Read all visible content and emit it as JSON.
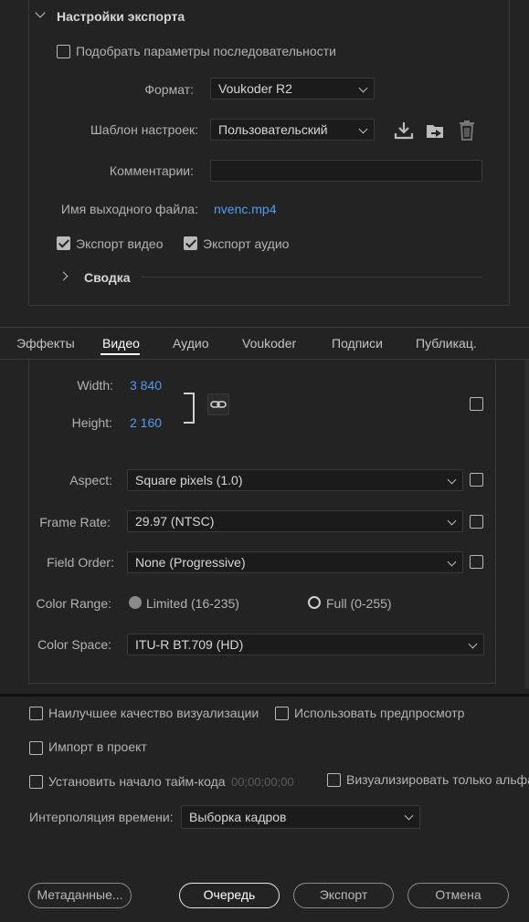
{
  "export_settings": {
    "title": "Настройки экспорта",
    "match_sequence": "Подобрать параметры последовательности",
    "format_label": "Формат:",
    "format_value": "Voukoder R2",
    "preset_label": "Шаблон настроек:",
    "preset_value": "Пользовательский",
    "comments_label": "Комментарии:",
    "comments_value": "",
    "output_name_label": "Имя выходного файла:",
    "output_name_value": "nvenc.mp4",
    "export_video": "Экспорт видео",
    "export_audio": "Экспорт аудио",
    "summary": "Сводка"
  },
  "tabs": [
    "Эффекты",
    "Видео",
    "Аудио",
    "Voukoder",
    "Подписи",
    "Публикац."
  ],
  "active_tab": "Видео",
  "video": {
    "width_label": "Width:",
    "width_value": "3 840",
    "height_label": "Height:",
    "height_value": "2 160",
    "aspect_label": "Aspect:",
    "aspect_value": "Square pixels (1.0)",
    "frame_rate_label": "Frame Rate:",
    "frame_rate_value": "29.97 (NTSC)",
    "field_order_label": "Field Order:",
    "field_order_value": "None (Progressive)",
    "color_range_label": "Color Range:",
    "color_range_limited": "Limited (16-235)",
    "color_range_full": "Full (0-255)",
    "color_space_label": "Color Space:",
    "color_space_value": "ITU-R BT.709 (HD)"
  },
  "bottom": {
    "max_render_quality": "Наилучшее качество визуализации",
    "use_previews": "Использовать предпросмотр",
    "import_into_project": "Импорт в проект",
    "set_start_timecode": "Установить начало тайм-кода",
    "timecode_value": "00;00;00;00",
    "render_alpha_only": "Визуализировать только альфа",
    "time_interpolation_label": "Интерполяция времени:",
    "time_interpolation_value": "Выборка кадров"
  },
  "buttons": {
    "metadata": "Метаданные...",
    "queue": "Очередь",
    "export": "Экспорт",
    "cancel": "Отмена"
  },
  "colors": {
    "background": "#232323",
    "link": "#4f9cf0"
  }
}
